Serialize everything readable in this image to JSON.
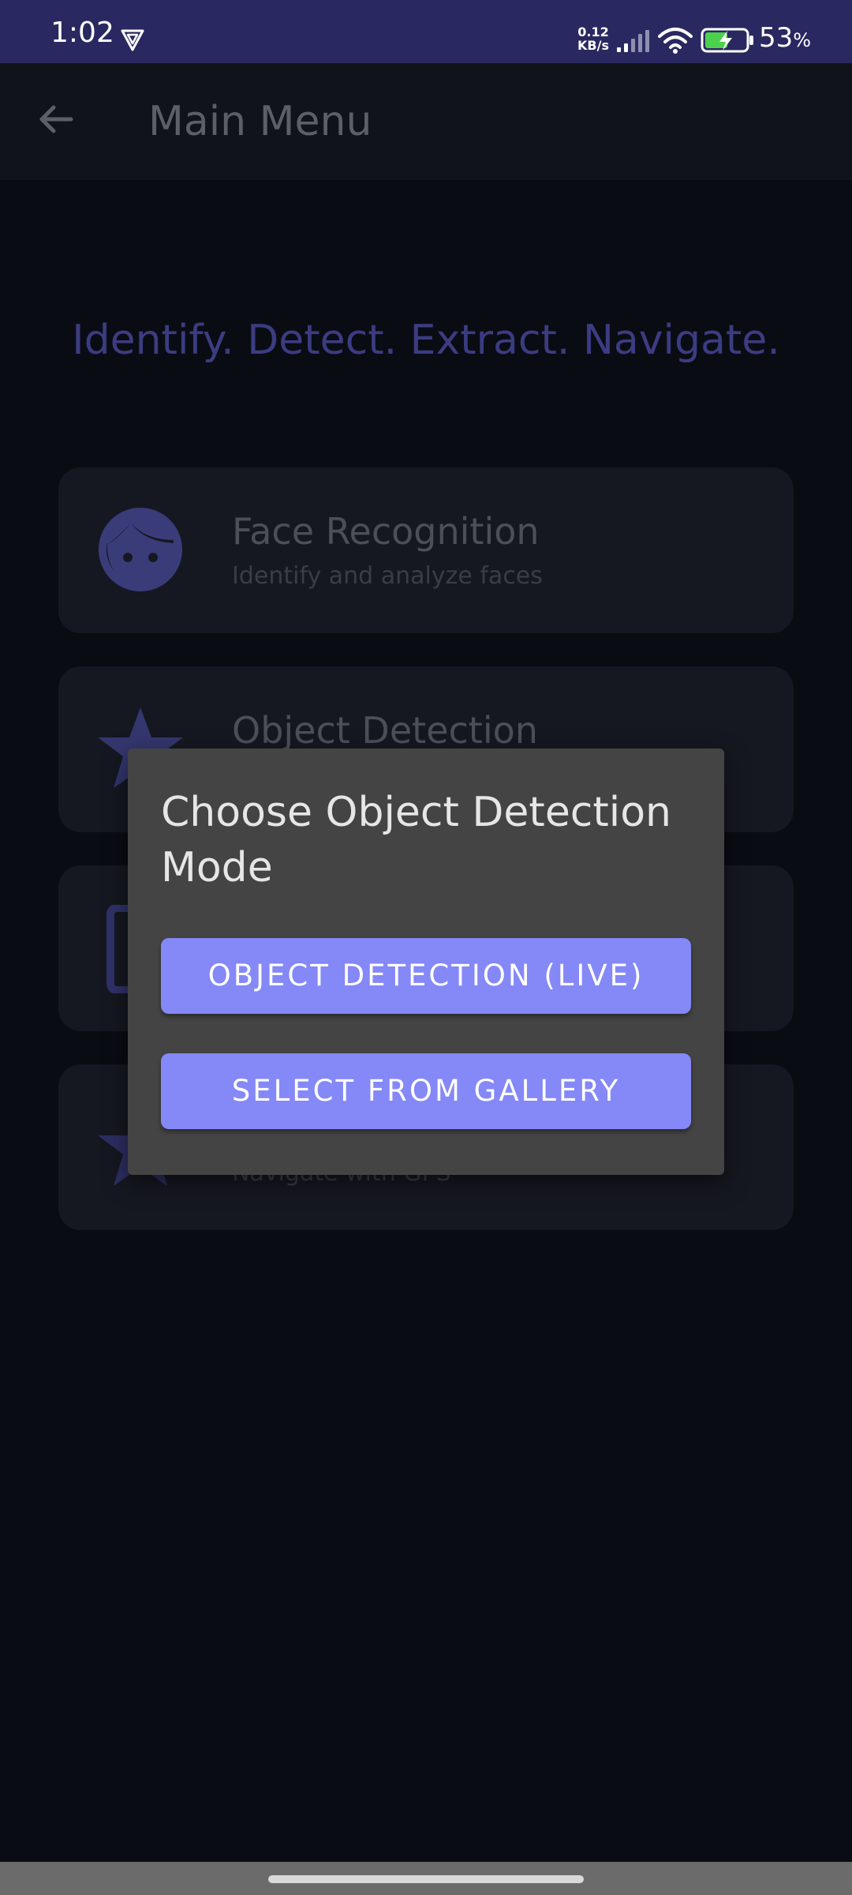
{
  "status_bar": {
    "time": "1:02",
    "net_speed_value": "0.12",
    "net_speed_unit": "KB/s",
    "battery_percent": "53",
    "battery_percent_sign": "%"
  },
  "app_bar": {
    "title": "Main Menu"
  },
  "tagline": "Identify. Detect. Extract. Navigate.",
  "cards": [
    {
      "title": "Face Recognition",
      "subtitle": "Identify and analyze faces",
      "icon": "face-icon"
    },
    {
      "title": "Object Detection",
      "subtitle": "",
      "icon": "star-icon"
    },
    {
      "title": "",
      "subtitle": "",
      "icon": "document-icon"
    },
    {
      "title": "",
      "subtitle": "Navigate with GPS",
      "icon": "navigation-icon"
    }
  ],
  "dialog": {
    "title": "Choose Object Detection Mode",
    "buttons": [
      {
        "label": "OBJECT DETECTION (LIVE)"
      },
      {
        "label": "SELECT FROM GALLERY"
      }
    ]
  },
  "colors": {
    "status_bar": "#2a2860",
    "background": "#0a0c14",
    "accent": "#8588f7",
    "dialog": "#444444",
    "tagline": "#3c3c82"
  }
}
